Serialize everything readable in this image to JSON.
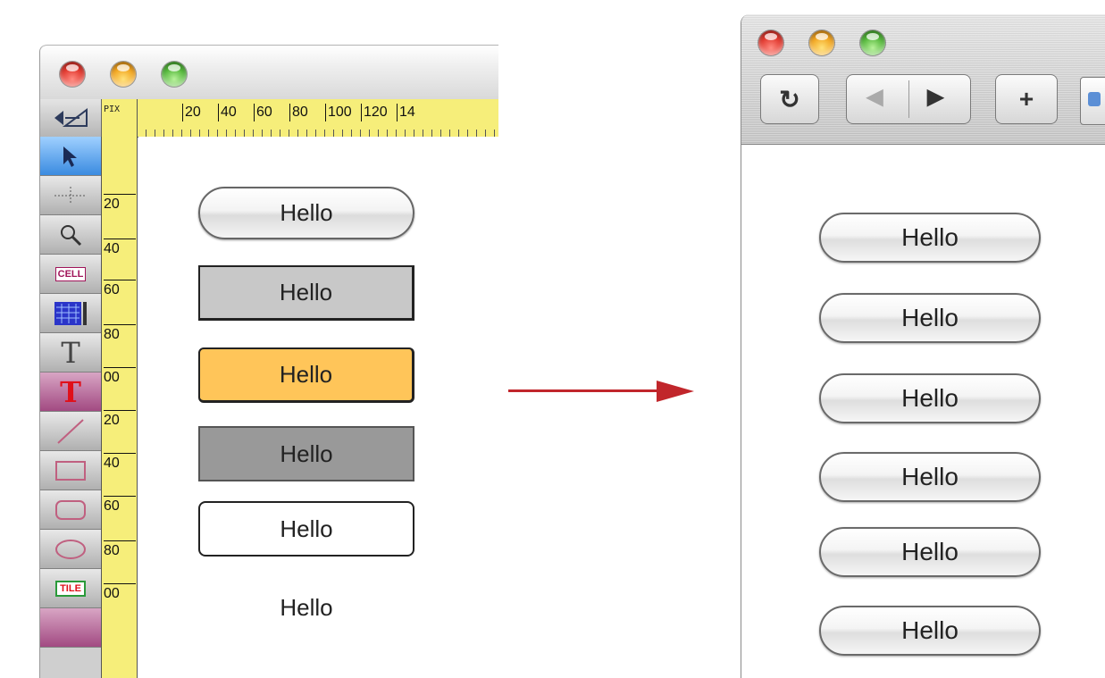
{
  "left_window": {
    "ruler": {
      "unit_label": "PIX",
      "h_labels": [
        "20",
        "40",
        "60",
        "80",
        "100",
        "120",
        "14"
      ],
      "v_labels": [
        "20",
        "40",
        "60",
        "80",
        "00",
        "20",
        "40",
        "60",
        "80",
        "00"
      ]
    },
    "tools": {
      "cell_label": "CELL",
      "text_label": "T",
      "tile_label": "TILE"
    },
    "buttons": [
      "Hello",
      "Hello",
      "Hello",
      "Hello",
      "Hello",
      "Hello"
    ]
  },
  "right_window": {
    "toolbar": {
      "reload_glyph": "↻",
      "back_glyph": "◀",
      "forward_glyph": "▶",
      "add_glyph": "+"
    },
    "buttons": [
      "Hello",
      "Hello",
      "Hello",
      "Hello",
      "Hello",
      "Hello"
    ]
  },
  "colors": {
    "arrow": "#c1262b",
    "ruler": "#f6ee7a",
    "orange_button": "#ffc559"
  }
}
